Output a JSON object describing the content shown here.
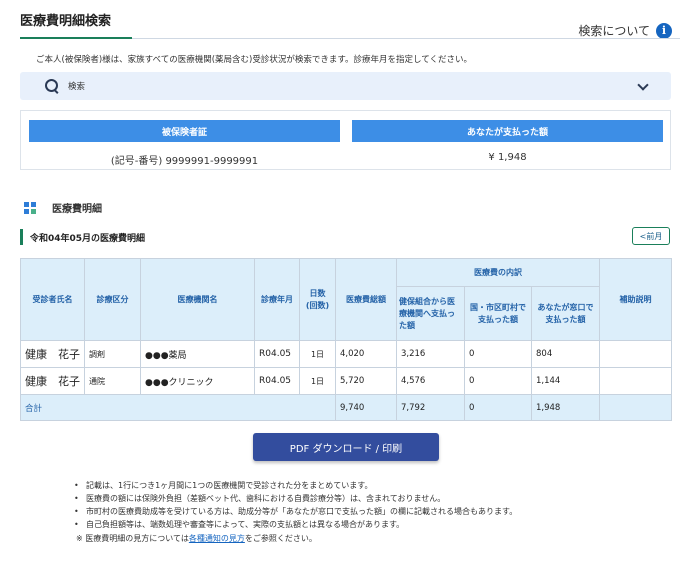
{
  "header": {
    "title": "医療費明細検索",
    "help_label": "検索について",
    "help_icon_glyph": "i"
  },
  "intro": "ご本人(被保険者)様は、家族すべての医療機関(薬局含む)受診状況が検索できます。診療年月を指定してください。",
  "search": {
    "label": "検索"
  },
  "summary": {
    "insured_header": "被保険者証",
    "insured_value": "(記号-番号) 9999991-9999991",
    "paid_header": "あなたが支払った額",
    "paid_value": "¥ 1,948"
  },
  "section": {
    "title": "医療費明細",
    "month_title": "令和04年05月の医療費明細",
    "prev_button": "<前月"
  },
  "table": {
    "headers": {
      "patient": "受診者氏名",
      "category": "診療区分",
      "institution": "医療機関名",
      "month": "診療年月",
      "days": "日数\n(回数)",
      "total": "医療費総額",
      "breakdown": "医療費の内訳",
      "insurer": "健保組合から医療機関へ支払った額",
      "municipal": "国・市区町村で支払った額",
      "you": "あなたが窓口で支払った額",
      "notes": "補助説明"
    },
    "rows": [
      {
        "patient": "健康　花子",
        "category": "調剤",
        "institution": "●●●薬局",
        "month": "R04.05",
        "days": "1日",
        "total": "4,020",
        "insurer": "3,216",
        "municipal": "0",
        "you": "804",
        "notes": ""
      },
      {
        "patient": "健康　花子",
        "category": "通院",
        "institution": "●●●クリニック",
        "month": "R04.05",
        "days": "1日",
        "total": "5,720",
        "insurer": "4,576",
        "municipal": "0",
        "you": "1,144",
        "notes": ""
      }
    ],
    "total_row": {
      "label": "合計",
      "total": "9,740",
      "insurer": "7,792",
      "municipal": "0",
      "you": "1,948"
    }
  },
  "pdf_button": "PDF ダウンロード / 印刷",
  "notes": {
    "items": [
      "記載は、1行につき1ヶ月間に1つの医療機関で受診された分をまとめています。",
      "医療費の額には保険外負担（差額ベット代、歯科における自費診療分等）は、含まれておりません。",
      "市町村の医療費助成等を受けている方は、助成分等が「あなたが窓口で支払った額」の欄に記載される場合もあります。",
      "自己負担額等は、端数処理や審査等によって、実際の支払額とは異なる場合があります。"
    ],
    "last_prefix": "※ 医療費明細の見方については",
    "last_link": "各種通知の見方",
    "last_suffix": "をご参照ください。"
  },
  "colors": {
    "accent_green": "#1a7f5a",
    "header_blue": "#3d8ee6",
    "button_navy": "#334d9e",
    "table_header_bg": "#dceefa",
    "search_bg": "#e8f0fb"
  }
}
